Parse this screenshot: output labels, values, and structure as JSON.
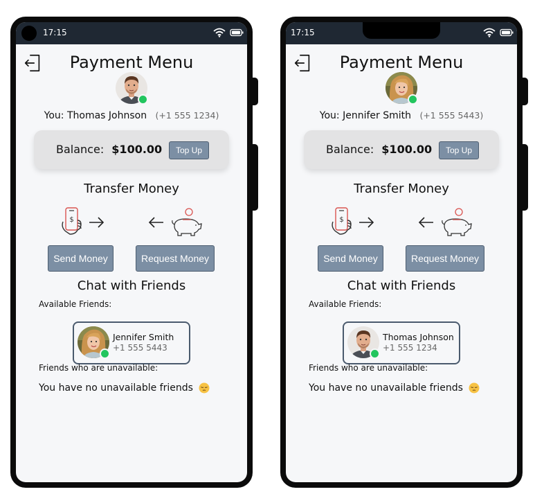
{
  "screens": [
    {
      "status_time": "17:15",
      "title": "Payment Menu",
      "user": {
        "prefix": "You:",
        "name": "Thomas Johnson",
        "phone": "(+1 555 1234)"
      },
      "balance": {
        "label": "Balance:",
        "value": "$100.00",
        "topup_label": "Top Up"
      },
      "transfer": {
        "title": "Transfer Money",
        "send_label": "Send Money",
        "request_label": "Request Money"
      },
      "chat": {
        "title": "Chat with Friends",
        "available_label": "Available Friends:",
        "friend": {
          "name": "Jennifer Smith",
          "phone": "+1 555 5443"
        },
        "unavailable_label": "Friends who are unavailable:",
        "no_unavailable_text": "You have no unavailable friends"
      }
    },
    {
      "status_time": "17:15",
      "title": "Payment Menu",
      "user": {
        "prefix": "You:",
        "name": "Jennifer Smith",
        "phone": "(+1 555 5443)"
      },
      "balance": {
        "label": "Balance:",
        "value": "$100.00",
        "topup_label": "Top Up"
      },
      "transfer": {
        "title": "Transfer Money",
        "send_label": "Send Money",
        "request_label": "Request Money"
      },
      "chat": {
        "title": "Chat with Friends",
        "available_label": "Available Friends:",
        "friend": {
          "name": "Thomas Johnson",
          "phone": "+1 555 1234"
        },
        "unavailable_label": "Friends who are unavailable:",
        "no_unavailable_text": "You have no unavailable friends"
      }
    }
  ],
  "icons": {
    "logout": "logout-icon",
    "wifi": "wifi-icon",
    "battery": "battery-icon",
    "send": "phone-money-icon",
    "request": "piggy-bank-icon",
    "emoji": "pensive-face-emoji"
  },
  "colors": {
    "status_bar": "#1f2833",
    "button": "#7c8fa4",
    "online": "#22c55e",
    "icon_accent": "#d9534f"
  }
}
